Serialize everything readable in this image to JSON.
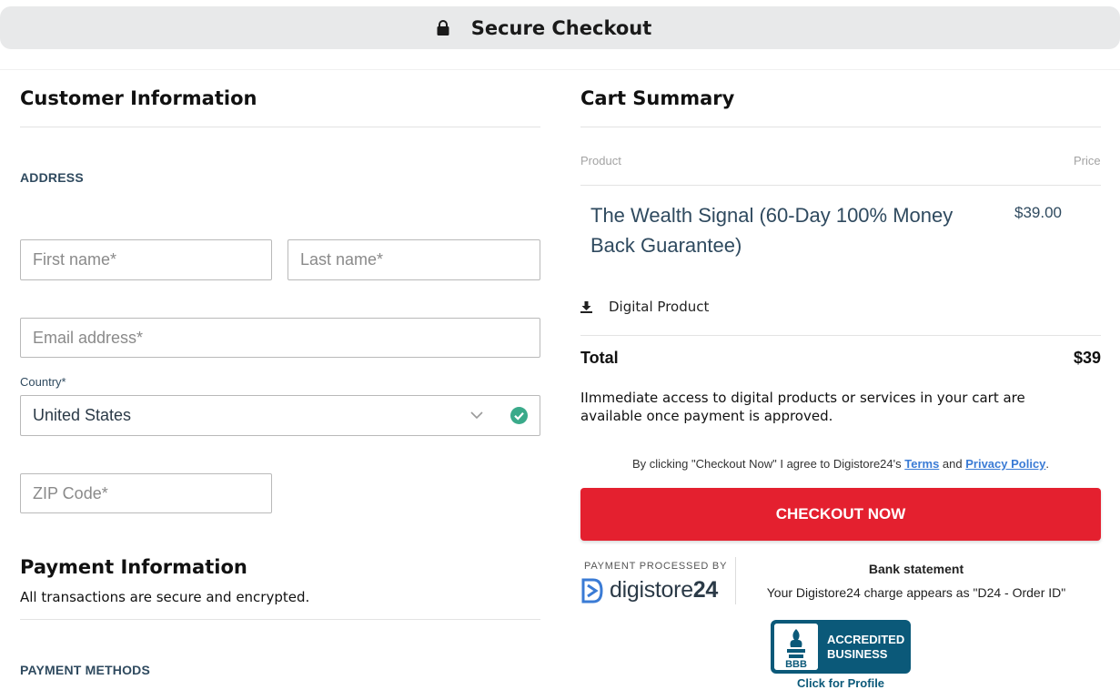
{
  "header": {
    "title": "Secure Checkout",
    "icon": "lock-icon"
  },
  "customer": {
    "heading": "Customer Information",
    "address_label": "ADDRESS",
    "first_name_placeholder": "First name*",
    "last_name_placeholder": "Last name*",
    "email_placeholder": "Email address*",
    "country_label": "Country*",
    "country_value": "United States",
    "zip_placeholder": "ZIP Code*"
  },
  "payment": {
    "heading": "Payment Information",
    "subtext": "All transactions are secure and encrypted.",
    "methods_label": "PAYMENT METHODS"
  },
  "cart": {
    "heading": "Cart Summary",
    "col_product": "Product",
    "col_price": "Price",
    "item_name": "The Wealth Signal (60-Day 100% Money Back Guarantee)",
    "item_price": "$39.00",
    "digital_label": "Digital Product",
    "total_label": "Total",
    "total_value": "$39",
    "access_note": "IImmediate access to digital products or services in your cart are available once payment is approved.",
    "agree_prefix": "By clicking \"Checkout Now\" I agree to Digistore24's ",
    "terms_link": "Terms",
    "agree_and": " and ",
    "privacy_link": "Privacy Policy",
    "agree_suffix": ".",
    "checkout_button": "CHECKOUT NOW"
  },
  "footer": {
    "processed_by": "PAYMENT PROCESSED BY",
    "brand_name": "digistore",
    "brand_suffix": "24",
    "bank_title": "Bank statement",
    "bank_text": "Your Digistore24 charge appears as \"D24 - Order ID\"",
    "bbb_line1": "ACCREDITED",
    "bbb_line2": "BUSINESS",
    "bbb_link": "Click for Profile"
  },
  "colors": {
    "accent_red": "#e4202f",
    "label_blue": "#2f4a5f",
    "success_green": "#3aaa8a",
    "bbb_blue": "#0b5979",
    "link_blue": "#3a7bd5"
  }
}
